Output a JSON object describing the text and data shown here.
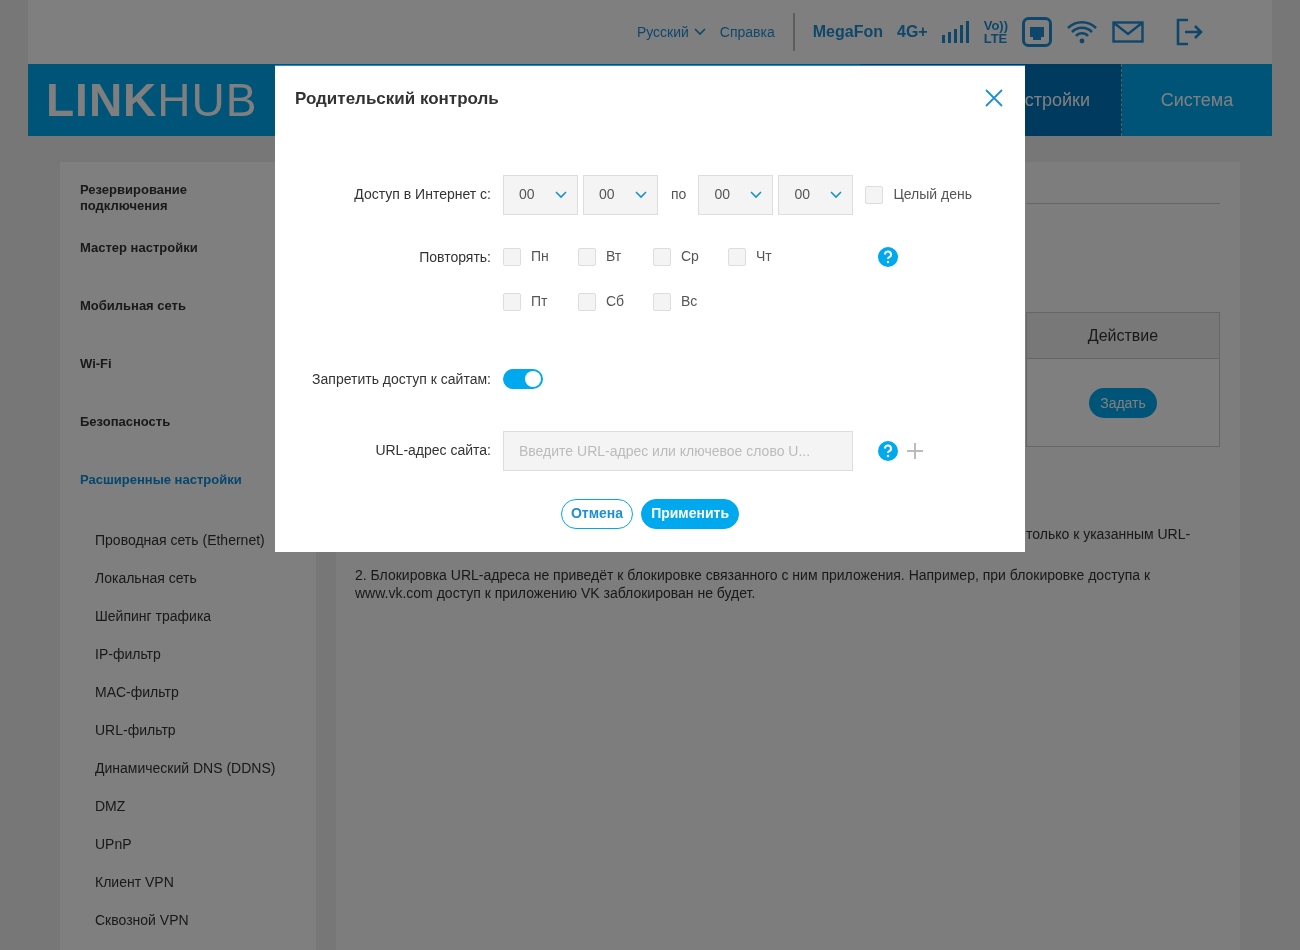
{
  "top_bar": {
    "language": "Русский",
    "help": "Справка",
    "operator": "MegaFon",
    "network": "4G+",
    "volte_top": "Vo))",
    "volte_bottom": "LTE"
  },
  "header": {
    "logo_bold": "LINK",
    "logo_light": "HUB",
    "tabs": [
      {
        "label": "стройки",
        "selected": true
      },
      {
        "label": "Система",
        "selected": false
      }
    ]
  },
  "sidebar": {
    "items": [
      {
        "label": "Резервирование подключения",
        "selected": false
      },
      {
        "label": "Мастер настройки",
        "selected": false
      },
      {
        "label": "Мобильная сеть",
        "selected": false
      },
      {
        "label": "Wi-Fi",
        "selected": false
      },
      {
        "label": "Безопасность",
        "selected": false
      },
      {
        "label": "Расширенные настройки",
        "selected": true,
        "children": [
          {
            "label": "Проводная сеть (Ethernet)",
            "selected": false
          },
          {
            "label": "Локальная сеть",
            "selected": false
          },
          {
            "label": "Шейпинг трафика",
            "selected": false
          },
          {
            "label": "IP-фильтр",
            "selected": false
          },
          {
            "label": "MAC-фильтр",
            "selected": false
          },
          {
            "label": "URL-фильтр",
            "selected": false
          },
          {
            "label": "Динамический DNS (DDNS)",
            "selected": false
          },
          {
            "label": "DMZ",
            "selected": false
          },
          {
            "label": "UPnP",
            "selected": false
          },
          {
            "label": "Клиент VPN",
            "selected": false
          },
          {
            "label": "Сквозной VPN",
            "selected": false
          }
        ]
      }
    ]
  },
  "content": {
    "table": {
      "column": "Действие",
      "button": "Задать"
    },
    "notes": [
      "только к указанным URL-",
      "2. Блокировка URL-адреса не приведёт к блокировке связанного с ним приложения. Например, при блокировке доступа к www.vk.com доступ к приложению VK заблокирован не будет."
    ]
  },
  "dialog": {
    "title": "Родительский контроль",
    "access_label": "Доступ в Интернет с:",
    "from": [
      "00",
      "00"
    ],
    "to_label": "по",
    "to": [
      "00",
      "00"
    ],
    "all_day": {
      "label": "Целый день",
      "checked": false
    },
    "repeat_label": "Повторять:",
    "days": [
      {
        "label": "Пн",
        "checked": false
      },
      {
        "label": "Вт",
        "checked": false
      },
      {
        "label": "Ср",
        "checked": false
      },
      {
        "label": "Чт",
        "checked": false
      },
      {
        "label": "Пт",
        "checked": false
      },
      {
        "label": "Сб",
        "checked": false
      },
      {
        "label": "Вс",
        "checked": false
      }
    ],
    "block_label": "Запретить доступ к сайтам:",
    "block_on": true,
    "url_label": "URL-адрес сайта:",
    "url_placeholder": "Введите URL-адрес или ключевое слово U...",
    "buttons": [
      "Отмена",
      "Применить"
    ]
  }
}
